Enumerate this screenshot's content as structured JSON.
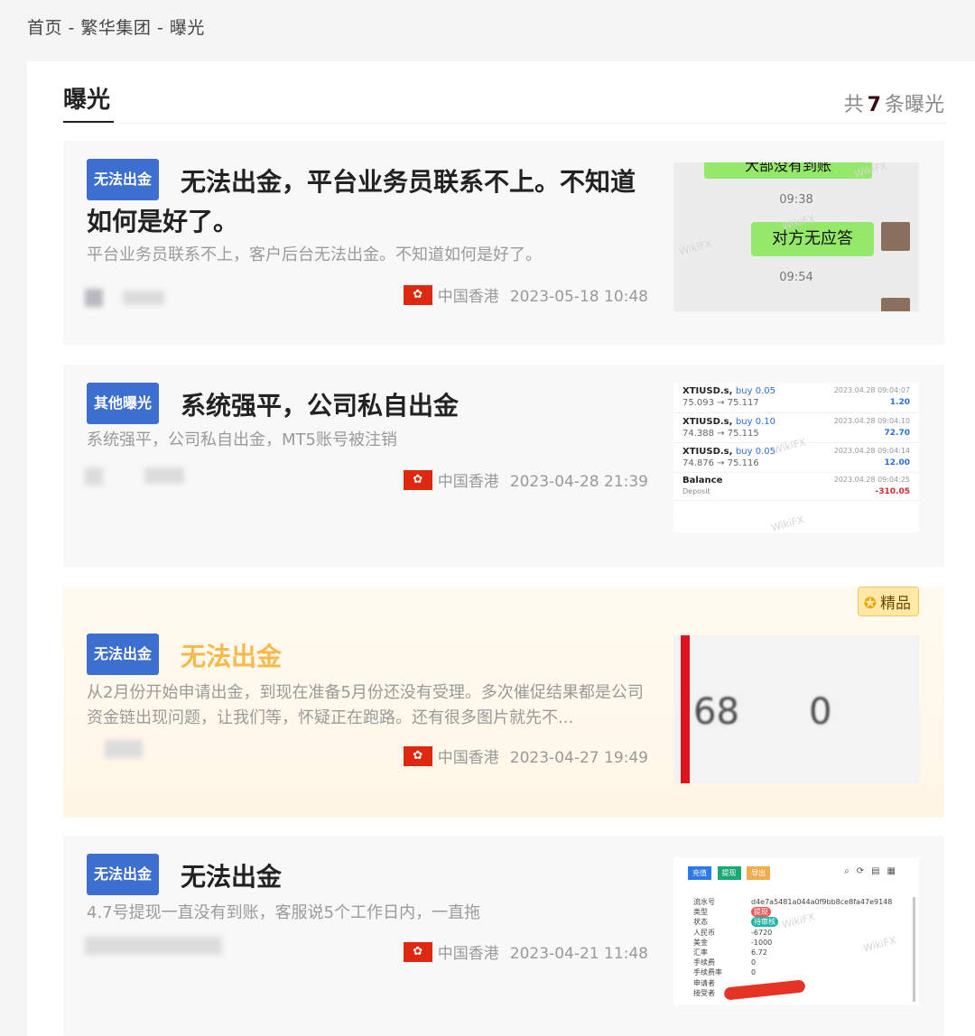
{
  "breadcrumb": "首页 - 繁华集团 - 曝光",
  "section": {
    "title": "曝光",
    "count_prefix": "共",
    "count": "7",
    "count_suffix": "条曝光"
  },
  "items": [
    {
      "tag": "无法出金",
      "title": "无法出金，平台业务员联系不上。不知道如何是好了。",
      "desc": "平台业务员联系不上，客户后台无法出金。不知道如何是好了。",
      "region": "中国香港",
      "date": "2023-05-18 10:48",
      "thumb": {
        "top_bubble": "大部没有到账",
        "time1": "09:38",
        "bubble": "对方无应答",
        "time2": "09:54"
      }
    },
    {
      "tag": "其他曝光",
      "title": "系统强平，公司私自出金",
      "desc": "系统强平，公司私自出金，MT5账号被注销",
      "region": "中国香港",
      "date": "2023-04-28 21:39",
      "thumb": {
        "rows": [
          {
            "sym": "XTIUSD.s,",
            "side": "buy 0.05",
            "range": "75.093 → 75.117",
            "time": "2023.04.28 09:04:07",
            "val": "1.20"
          },
          {
            "sym": "XTIUSD.s,",
            "side": "buy 0.10",
            "range": "74.388 → 75.115",
            "time": "2023.04.28 09:04:10",
            "val": "72.70"
          },
          {
            "sym": "XTIUSD.s,",
            "side": "buy 0.05",
            "range": "74.876 → 75.116",
            "time": "2023.04.28 09:04:14",
            "val": "12.00"
          }
        ],
        "balance": {
          "label": "Balance",
          "sub": "Deposit",
          "time": "2023.04.28 09:04:25",
          "val": "-310.05"
        }
      }
    },
    {
      "tag": "无法出金",
      "title": "无法出金",
      "desc": "从2月份开始申请出金，到现在准备5月份还没有受理。多次催促结果都是公司资金链出现问题，让我们等，怀疑正在跑路。还有很多图片就先不...",
      "region": "中国香港",
      "date": "2023-04-27 19:49",
      "badge": "精品",
      "thumb": {
        "n1": "68",
        "n2": "0"
      }
    },
    {
      "tag": "无法出金",
      "title": "无法出金",
      "desc": "4.7号提现一直没有到账，客服说5个工作日内，一直拖",
      "region": "中国香港",
      "date": "2023-04-21 11:48",
      "thumb": {
        "btn1": "充值",
        "btn2": "提现",
        "btn3": "导出",
        "fields": [
          {
            "k": "流水号",
            "v": "d4e7a5481a044a0f9bb8ce8fa47e9148"
          },
          {
            "k": "类型",
            "v": "提现"
          },
          {
            "k": "状态",
            "v": "待审核"
          },
          {
            "k": "人民币",
            "v": "-6720"
          },
          {
            "k": "美金",
            "v": "-1000"
          },
          {
            "k": "汇率",
            "v": "6.72"
          },
          {
            "k": "手续费",
            "v": "0"
          },
          {
            "k": "手续费率",
            "v": "0"
          },
          {
            "k": "申请者",
            "v": ""
          },
          {
            "k": "接受者",
            "v": ""
          }
        ]
      }
    }
  ],
  "watermark": "WikiFX",
  "colors": {
    "tag": "#3d6fd1",
    "gold_title": "#f7b94a",
    "flag": "#de2910"
  }
}
